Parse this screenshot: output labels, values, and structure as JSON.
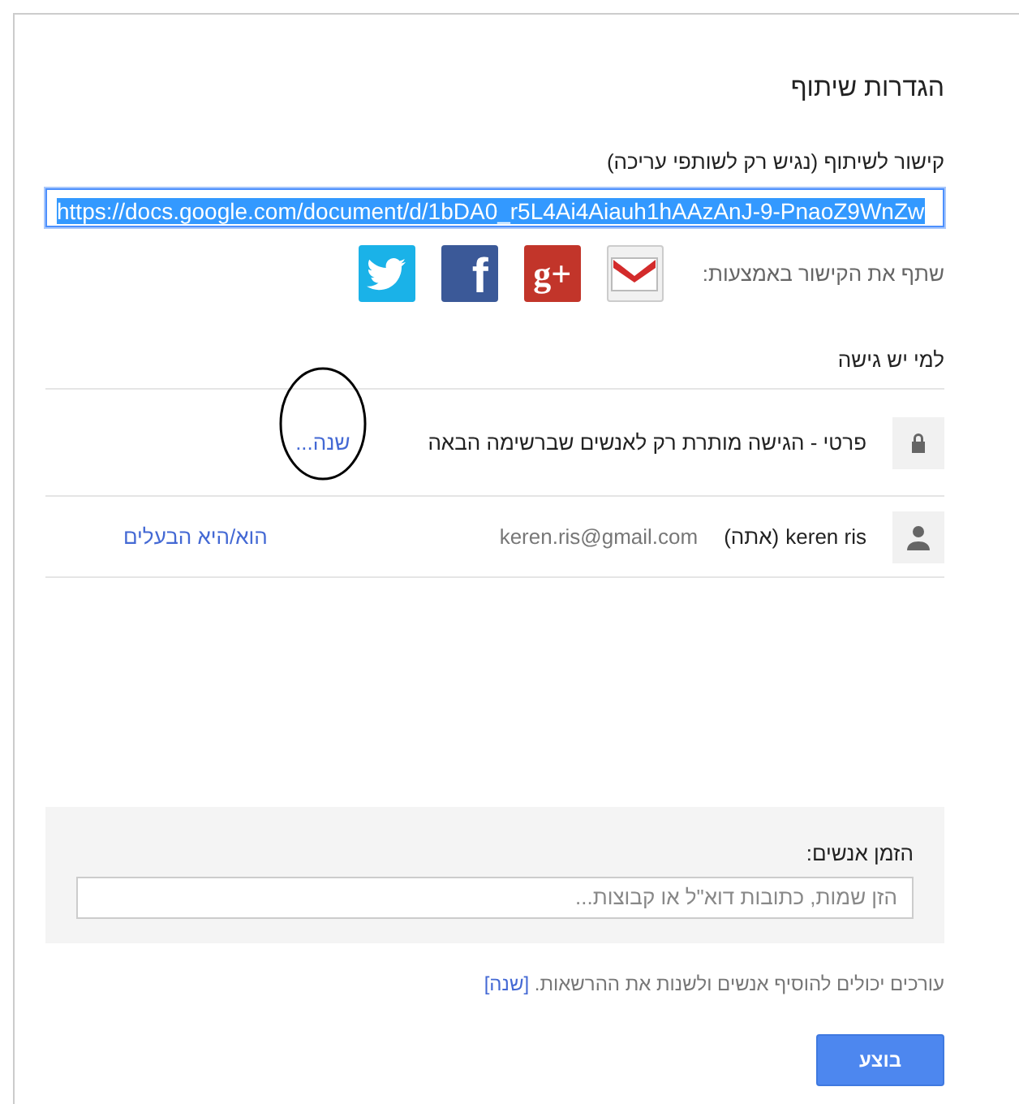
{
  "dialog": {
    "title": "הגדרות שיתוף"
  },
  "link": {
    "label": "קישור לשיתוף (נגיש רק לשותפי עריכה)",
    "value": "https://docs.google.com/document/d/1bDA0_r5L4Ai4Aiauh1hAAzAnJ-9-PnaoZ9WnZw",
    "selected": true
  },
  "share": {
    "label": "שתף את הקישור באמצעות:",
    "services": [
      {
        "kind": "gmail"
      },
      {
        "kind": "gplus",
        "glyph": "g+"
      },
      {
        "kind": "facebook",
        "glyph": "f"
      },
      {
        "kind": "twitter"
      }
    ]
  },
  "access": {
    "heading": "למי יש גישה",
    "rows": [
      {
        "kind": "visibility",
        "text": "פרטי - הגישה מותרת רק לאנשים שברשימה הבאה",
        "action": "שנה...",
        "circled": true
      },
      {
        "kind": "person",
        "name": "keren ris",
        "you": "(אתה)",
        "email": "keren.ris@gmail.com",
        "role": "הוא/היא הבעלים",
        "circled": false
      }
    ]
  },
  "invite": {
    "label": "הזמן אנשים:",
    "placeholder": "הזן שמות, כתובות דוא\"ל או קבוצות..."
  },
  "note": {
    "text": "עורכים יכולים להוסיף אנשים ולשנות את ההרשאות.",
    "link": "[שנה]"
  },
  "buttons": [
    {
      "label": "בוצע",
      "kind": "primary"
    }
  ]
}
